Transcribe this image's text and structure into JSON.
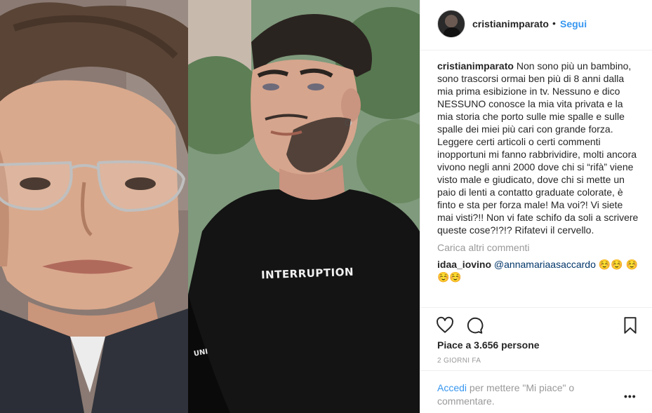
{
  "post": {
    "shirt_text": "INTERRUPTION",
    "sleeve_text": "UNI"
  },
  "header": {
    "username": "cristianimparato",
    "separator": "•",
    "follow_label": "Segui"
  },
  "caption": {
    "username": "cristianimparato",
    "text": "Non sono più un bambino, sono trascorsi ormai ben più di 8 anni dalla mia prima esibizione in tv. Nessuno e dico NESSUNO conosce la mia vita privata e la mia storia che porto sulle mie spalle e sulle spalle dei miei più cari con grande forza. Leggere certi articoli o certi commenti inopportuni mi fanno rabbrividire, molti ancora vivono negli anni 2000 dove chi si “rifà” viene visto male e giudicato, dove chi si mette un paio di lenti a contatto graduate colorate, è finto e sta per forza male! Ma voi?! Vi siete mai visti?!! Non vi fate schifo da soli a scrivere queste cose?!?!? Rifatevi il cervello."
  },
  "load_more_label": "Carica altri commenti",
  "comments": [
    {
      "username": "idaa_iovino",
      "mention": "@annamariaasaccardo",
      "emoji": "☺️☺️ ☺️☺️☺️"
    }
  ],
  "actions": {
    "like_icon": "heart-icon",
    "comment_icon": "comment-icon",
    "save_icon": "bookmark-icon",
    "likes_text": "Piace a 3.656 persone",
    "time_text": "2 GIORNI FA"
  },
  "footer": {
    "login_link": "Accedi",
    "login_text": " per mettere \"Mi piace\" o commentare.",
    "more_icon": "ellipsis-icon",
    "more_label": "•••"
  },
  "colors": {
    "accent": "#3897f0",
    "text": "#262626",
    "muted": "#999999",
    "border": "#efefef"
  }
}
